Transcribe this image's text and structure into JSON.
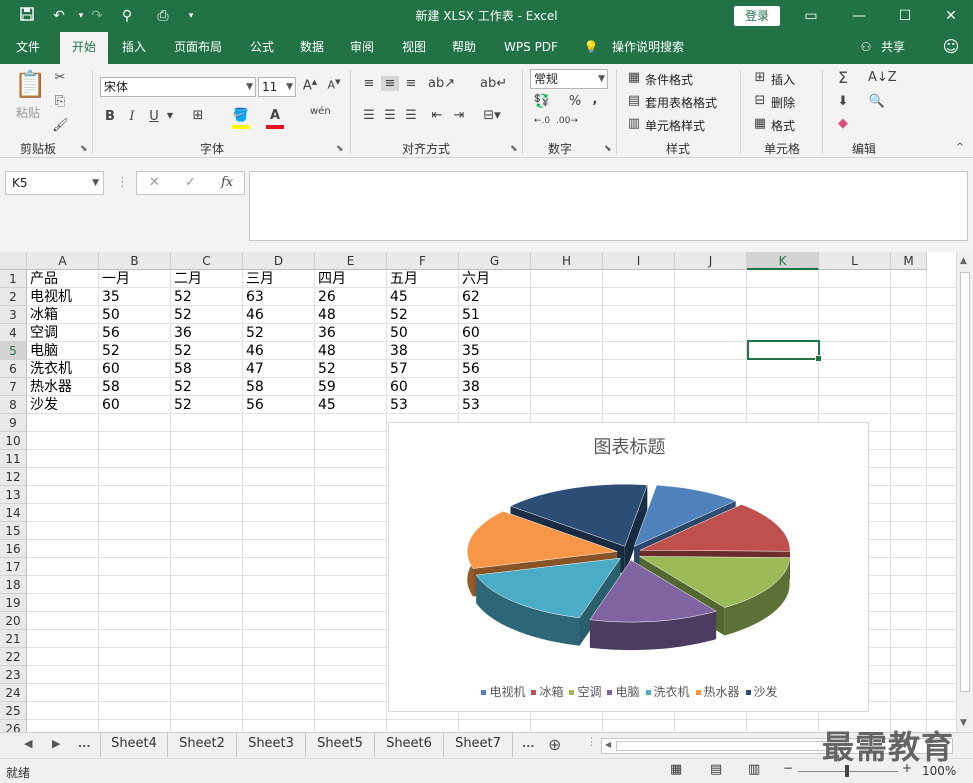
{
  "window": {
    "title": "新建 XLSX 工作表  -  Excel",
    "login_label": "登录"
  },
  "menu_tabs": [
    "文件",
    "开始",
    "插入",
    "页面布局",
    "公式",
    "数据",
    "审阅",
    "视图",
    "帮助",
    "WPS PDF",
    "操作说明搜索"
  ],
  "share_label": "共享",
  "ribbon": {
    "clipboard": {
      "paste_label": "粘贴",
      "group_label": "剪贴板"
    },
    "font": {
      "font_name": "宋体",
      "font_size": "11",
      "bold": "B",
      "italic": "I",
      "underline": "U",
      "group_label": "字体"
    },
    "alignment": {
      "group_label": "对齐方式"
    },
    "number": {
      "format": "常规",
      "percent": "%",
      "group_label": "数字"
    },
    "styles": {
      "conditional": "条件格式",
      "table_format": "套用表格格式",
      "cell_style": "单元格样式",
      "group_label": "样式"
    },
    "cells": {
      "insert": "插入",
      "delete": "删除",
      "format": "格式",
      "group_label": "单元格"
    },
    "editing": {
      "group_label": "编辑"
    }
  },
  "formula_bar": {
    "name_box": "K5",
    "fx_label": "fx",
    "formula": ""
  },
  "columns": [
    "A",
    "B",
    "C",
    "D",
    "E",
    "F",
    "G",
    "H",
    "I",
    "J",
    "K",
    "L",
    "M"
  ],
  "rows": [
    "1",
    "2",
    "3",
    "4",
    "5",
    "6",
    "7",
    "8",
    "9",
    "10",
    "11",
    "12",
    "13",
    "14",
    "15",
    "16",
    "17",
    "18",
    "19",
    "20",
    "21",
    "22",
    "23",
    "24",
    "25",
    "26"
  ],
  "table": [
    [
      "产品",
      "一月",
      "二月",
      "三月",
      "四月",
      "五月",
      "六月"
    ],
    [
      "电视机",
      "35",
      "52",
      "63",
      "26",
      "45",
      "62"
    ],
    [
      "冰箱",
      "50",
      "52",
      "46",
      "48",
      "52",
      "51"
    ],
    [
      "空调",
      "56",
      "36",
      "52",
      "36",
      "50",
      "60"
    ],
    [
      "电脑",
      "52",
      "52",
      "46",
      "48",
      "38",
      "35"
    ],
    [
      "洗衣机",
      "60",
      "58",
      "47",
      "52",
      "57",
      "56"
    ],
    [
      "热水器",
      "58",
      "52",
      "58",
      "59",
      "60",
      "38"
    ],
    [
      "沙发",
      "60",
      "52",
      "56",
      "45",
      "53",
      "53"
    ]
  ],
  "chart_data": {
    "type": "pie",
    "title": "图表标题",
    "categories": [
      "电视机",
      "冰箱",
      "空调",
      "电脑",
      "洗衣机",
      "热水器",
      "沙发"
    ],
    "values": [
      35,
      50,
      56,
      52,
      60,
      58,
      60
    ],
    "colors": [
      "#4f81bd",
      "#c0504d",
      "#9bbb59",
      "#8064a2",
      "#4bacc6",
      "#f79646",
      "#2c4d75"
    ],
    "legend": "bottom"
  },
  "sheets": [
    "Sheet4",
    "Sheet2",
    "Sheet3",
    "Sheet5",
    "Sheet6",
    "Sheet7"
  ],
  "sheet_more": "...",
  "status": {
    "ready": "就绪",
    "zoom": "100%"
  },
  "watermark": "最需教育"
}
